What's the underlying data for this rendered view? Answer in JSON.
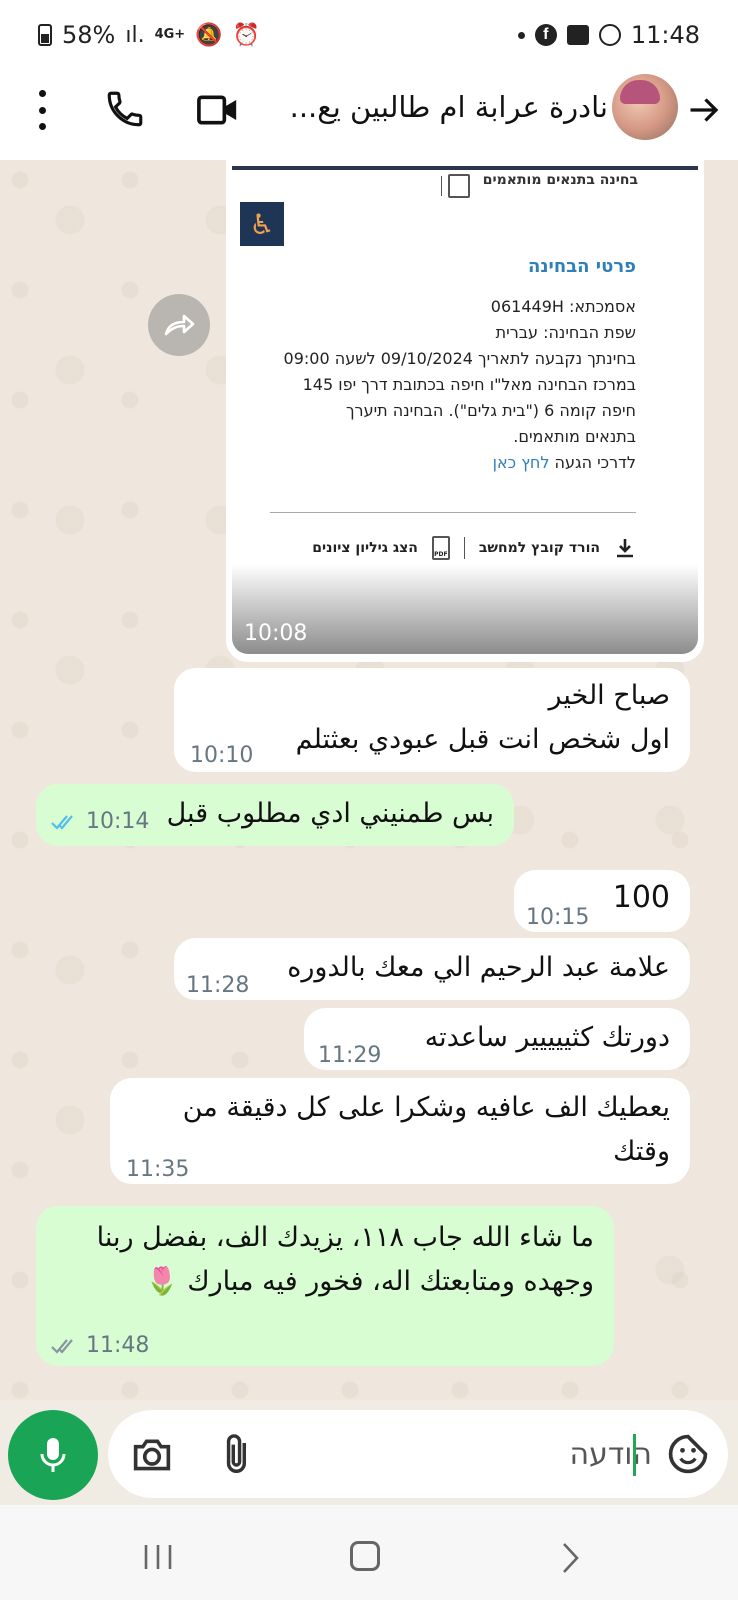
{
  "status_bar": {
    "battery": "58%",
    "network": "4G+",
    "time": "11:48"
  },
  "header": {
    "contact_name": "نادرة عرابة ام طالبين يع...",
    "icons": [
      "menu-dots-icon",
      "phone-icon",
      "video-icon",
      "avatar",
      "back-arrow-icon"
    ]
  },
  "document_message": {
    "top_label": "בחינה בתנאים מותאמים",
    "section_title": "פרטי הבחינה",
    "lines": [
      "אסמכתא: 061449H",
      "שפת הבחינה: עברית",
      "בחינתך נקבעה לתאריך 09/10/2024 לשעה 09:00",
      "במרכז הבחינה מאל\"ו חיפה בכתובת דרך יפו 145",
      "חיפה קומה 6 (\"בית גלים\"). הבחינה תיערך",
      "בתנאים מותאמים."
    ],
    "directions_prefix": "לדרכי הגעה",
    "directions_link": "לחץ כאן",
    "download_label": "הורד קובץ למחשב",
    "grades_label": "הצג גיליון ציונים",
    "time": "10:08"
  },
  "messages": [
    {
      "dir": "in",
      "lines": [
        "صباح الخير",
        "اول شخص انت قبل عبودي بعثتلم"
      ],
      "time": "10:10"
    },
    {
      "dir": "out",
      "lines": [
        "بس طمنيني ادي مطلوب قبل"
      ],
      "time": "10:14"
    },
    {
      "dir": "in",
      "lines": [
        "100"
      ],
      "time": "10:15"
    },
    {
      "dir": "in",
      "lines": [
        "علامة عبد الرحيم الي معك بالدوره"
      ],
      "time": "11:28"
    },
    {
      "dir": "in",
      "lines": [
        "دورتك كثييييير ساعدته"
      ],
      "time": "11:29"
    },
    {
      "dir": "in",
      "lines": [
        "يعطيك الف عافيه وشكرا على كل دقيقة من",
        "وقتك"
      ],
      "time": "11:35"
    },
    {
      "dir": "out",
      "lines": [
        "ما شاء الله جاب ١١٨، يزيدك الف، بفضل ربنا",
        "وجهده ومتابعتك اله، فخور فيه مبارك 🌷"
      ],
      "time": "11:48"
    }
  ],
  "input": {
    "placeholder": "הודעה"
  },
  "colors": {
    "outgoing_bubble": "#d9fdd3",
    "incoming_bubble": "#ffffff",
    "accent_green": "#1aa556",
    "read_ticks": "#53bdeb"
  }
}
